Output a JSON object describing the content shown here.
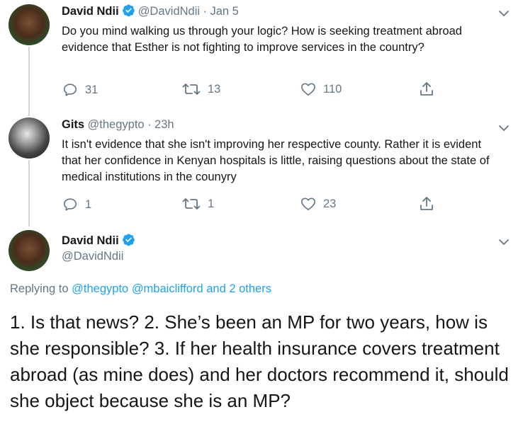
{
  "tweets": [
    {
      "name": "David Ndii",
      "handle": "@DavidNdii",
      "separator": "·",
      "time": "Jan 5",
      "text": "Do you mind walking us through your logic? How is seeking treatment abroad evidence that Esther is not fighting to improve services in the country?",
      "replies": "31",
      "retweets": "13",
      "likes": "110"
    },
    {
      "name": "Gits",
      "handle": "@thegypto",
      "separator": "·",
      "time": "23h",
      "text": "It isn't evidence that she isn't improving her respective county. Rather it is evident that her confidence in Kenyan hospitals is little, raising questions about the state of medical institutions in the counyry",
      "replies": "1",
      "retweets": "1",
      "likes": "23"
    }
  ],
  "main_tweet": {
    "name": "David Ndii",
    "handle": "@DavidNdii",
    "replying_prefix": "Replying to",
    "replying_to_1": "@thegypto",
    "replying_to_2": "@mbaiclifford",
    "replying_others": "and 2 others",
    "text": "1. Is that news? 2. She’s been an MP for two years, how is she responsible? 3. If her health insurance covers treatment abroad (as mine does) and her doctors recommend it, should she object because she is an MP?"
  },
  "colors": {
    "accent": "#1da1f2",
    "secondary_text": "#657786",
    "thread_line": "#ccd6dd"
  },
  "icons": [
    "verified-badge-icon",
    "chevron-down-icon",
    "reply-icon",
    "retweet-icon",
    "like-icon",
    "share-icon"
  ]
}
